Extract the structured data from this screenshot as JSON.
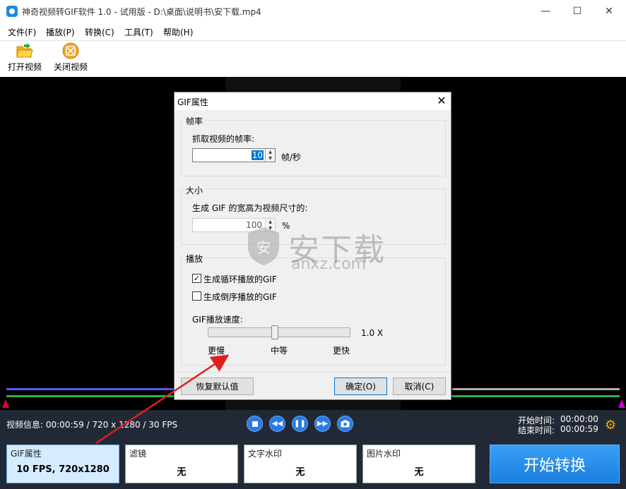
{
  "window": {
    "title": "神奇视频转GIF软件 1.0 - 试用版 - D:\\桌面\\说明书\\安下载.mp4",
    "minimize": "—",
    "maximize": "☐",
    "close": "✕"
  },
  "menu": [
    "文件(F)",
    "播放(P)",
    "转换(C)",
    "工具(T)",
    "帮助(H)"
  ],
  "toolbar": {
    "open_video": "打开视频",
    "close_video": "关闭视频"
  },
  "player": {
    "video_info": "视频信息: 00:00:59 / 720 x 1280 / 30 FPS",
    "start_time_label": "开始时间:",
    "start_time": "00:00:00",
    "end_time_label": "结束时间:",
    "end_time": "00:00:59"
  },
  "cards": {
    "gif": {
      "title": "GIF属性",
      "value": "10 FPS, 720x1280"
    },
    "filter": {
      "title": "滤镜",
      "value": "无"
    },
    "text_watermark": {
      "title": "文字水印",
      "value": "无"
    },
    "image_watermark": {
      "title": "图片水印",
      "value": "无"
    }
  },
  "start_button": "开始转换",
  "dialog": {
    "title": "GIF属性",
    "close": "✕",
    "framerate": {
      "group_title": "帧率",
      "label": "抓取视频的帧率:",
      "value": "10",
      "unit": "帧/秒"
    },
    "size": {
      "group_title": "大小",
      "label": "生成 GIF 的宽高为视频尺寸的:",
      "value": "100",
      "unit": "%"
    },
    "playback": {
      "group_title": "播放",
      "loop_label": "生成循环播放的GIF",
      "loop_checked": true,
      "reverse_label": "生成倒序播放的GIF",
      "reverse_checked": false,
      "speed_label": "GIF播放速度:",
      "speed_value": "1.0 X",
      "speed_position": 0.47,
      "slow": "更慢",
      "medium": "中等",
      "fast": "更快"
    },
    "reset_button": "恢复默认值",
    "ok_button": "确定(O)",
    "cancel_button": "取消(C)"
  },
  "watermark": {
    "main": "安下载",
    "sub": "anxz.com"
  },
  "colors": {
    "accent_blue": "#1a7fde",
    "bottom_panel": "#222936",
    "annotation_arrow": "#e02020"
  }
}
